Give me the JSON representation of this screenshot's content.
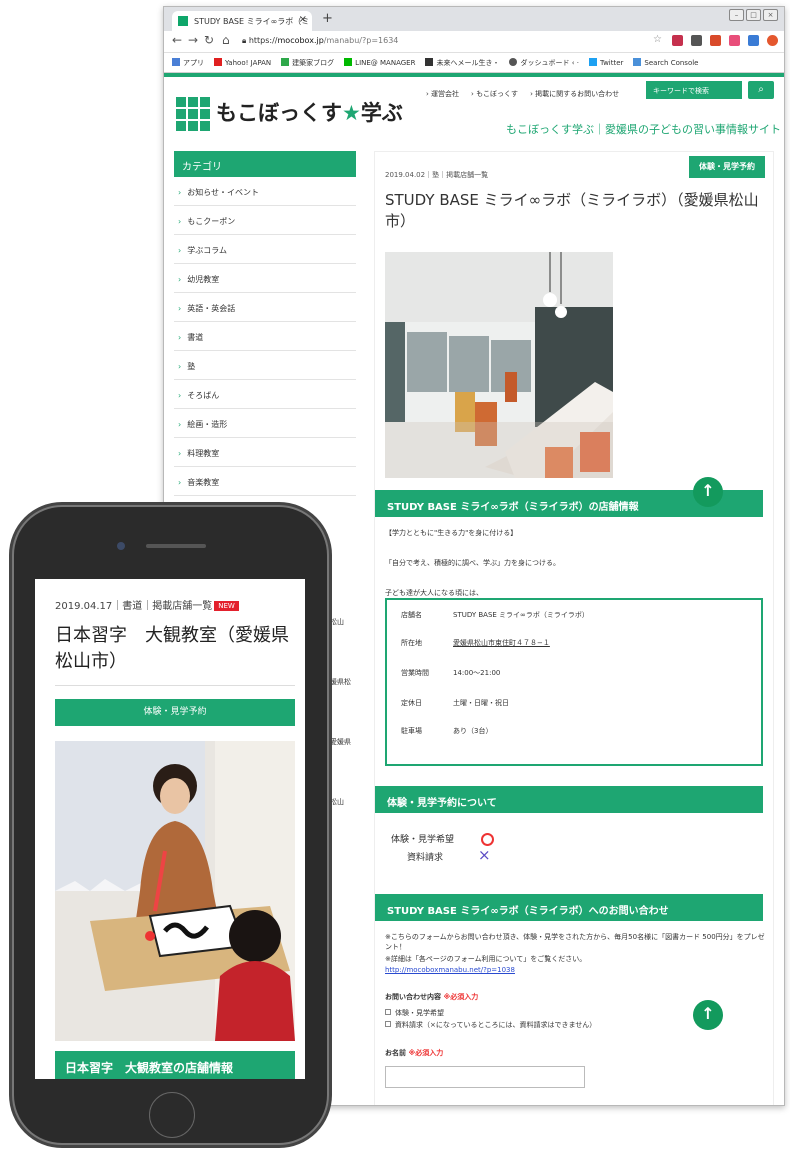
{
  "browser": {
    "tab_title": "STUDY BASE ミライ∞ラボ（ミ",
    "url_scheme": "https://",
    "url_host": "mocobox.jp",
    "url_path": "/manabu/?p=1634",
    "bookmarks": [
      "アプリ",
      "Yahoo! JAPAN",
      "建築家ブログ",
      "LINE@ MANAGER",
      "未来へメール生き・",
      "ダッシュボード ‹ ·",
      "Twitter",
      "Search Console"
    ]
  },
  "site": {
    "logo": "もこぼっくす★学ぶ",
    "logo_main": "もこぼっくす",
    "logo_star": "★",
    "logo_end": "学ぶ",
    "nav": [
      "運営会社",
      "もこぼっくす",
      "掲載に関するお問い合わせ"
    ],
    "search_placeholder": "キーワードで検索",
    "tagline": "もこぼっくす学ぶ｜愛媛県の子どもの習い事情報サイト"
  },
  "sidebar": {
    "heading": "カテゴリ",
    "items": [
      "お知らせ・イベント",
      "もこクーポン",
      "学ぶコラム",
      "幼児教室",
      "英語・英会話",
      "書道",
      "塾",
      "そろばん",
      "絵画・造形",
      "料理教室",
      "音楽教室"
    ]
  },
  "article": {
    "meta": "2019.04.02｜塾｜掲載店舗一覧",
    "badge": "体験・見学予約",
    "title": "STUDY BASE ミライ∞ラボ（ミライラボ）（愛媛県松山市）",
    "info_heading": "STUDY BASE ミライ∞ラボ（ミライラボ）の店舗情報",
    "intro": [
      "【学力とともに\"生きる力\"を身に付ける】",
      "「自分で考え、積極的に調べ、学ぶ」力を身につける。",
      "子ども達が大人になる頃には、"
    ],
    "info_rows": [
      {
        "k": "店舗名",
        "v": "STUDY BASE ミライ∞ラボ（ミライラボ）"
      },
      {
        "k": "所在地",
        "v": "愛媛県松山市束住町４７８−１"
      },
      {
        "k": "営業時間",
        "v": "14:00〜21:00"
      },
      {
        "k": "定休日",
        "v": "土曜・日曜・祝日"
      },
      {
        "k": "駐車場",
        "v": "あり（3台）"
      }
    ],
    "trial_heading": "体験・見学予約について",
    "trial_label": "体験・見学希望",
    "docs_label": "資料請求",
    "contact_heading": "STUDY BASE ミライ∞ラボ（ミライラボ）へのお問い合わせ",
    "note1": "※こちらのフォームからお問い合わせ頂き、体験・見学をされた方から、毎月50名様に「図書カード 500円分」をプレゼント！",
    "note2": "※詳細は「各ページのフォーム利用について」をご覧ください。",
    "note_link": "http://mocoboxmanabu.net/?p=1038",
    "form_label": "お問い合わせ内容",
    "required": "※必須入力",
    "opt1": "体験・見学希望",
    "opt2": "資料請求（×になっているところには、資料請求はできません）",
    "name_label": "お名前",
    "bleed_texts": [
      "松山",
      "媛県松",
      "愛媛県",
      "松山"
    ]
  },
  "phone": {
    "meta": "2019.04.17｜書道｜掲載店舗一覧",
    "new_badge": "NEW",
    "title": "日本習字　大観教室（愛媛県松山市）",
    "button": "体験・見学予約",
    "info_band": "日本習字　大観教室の店舗情報"
  }
}
